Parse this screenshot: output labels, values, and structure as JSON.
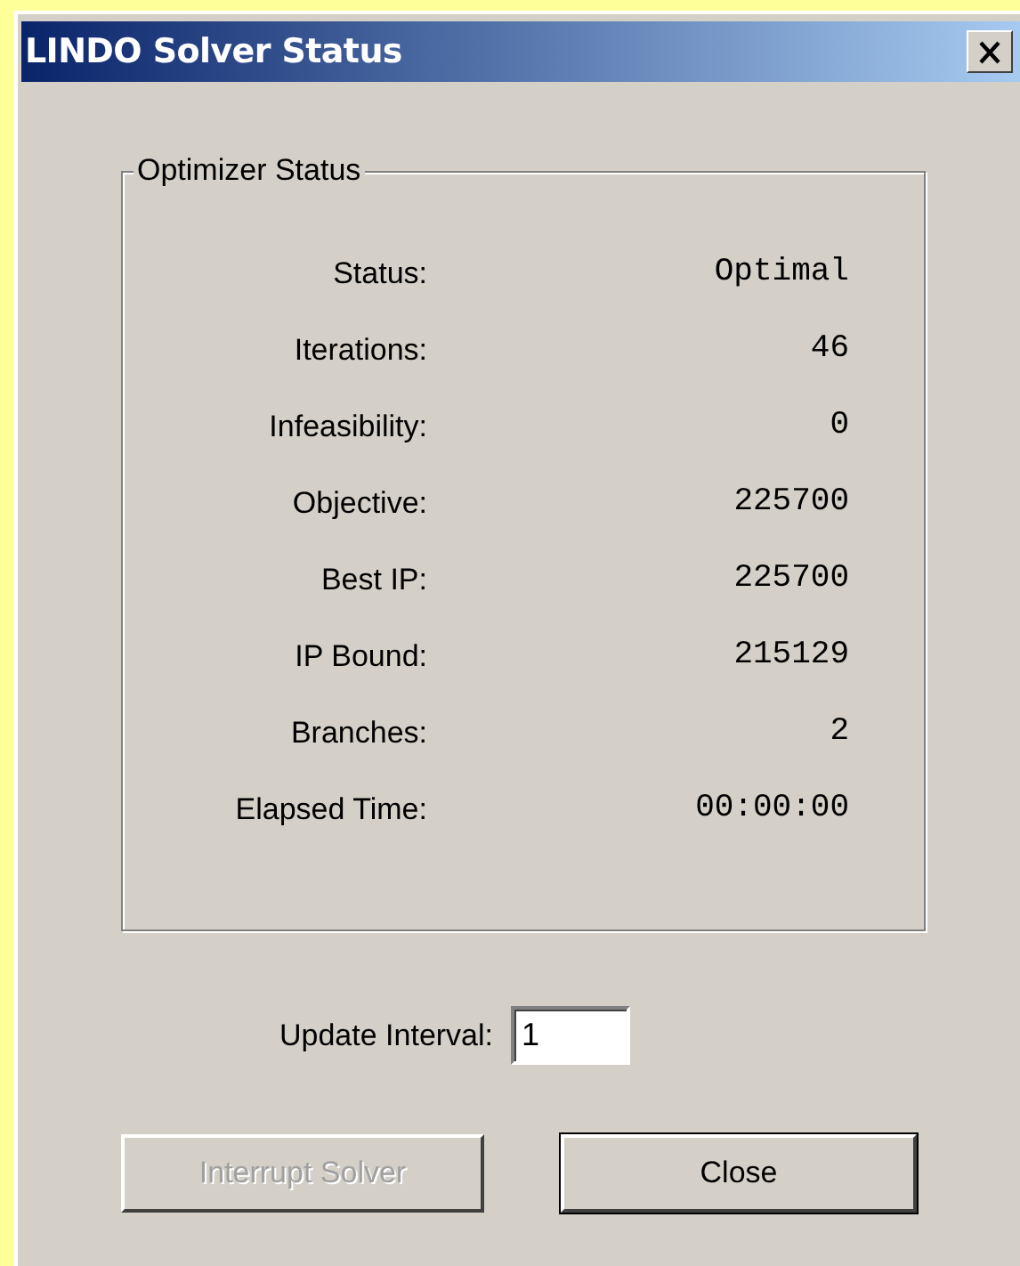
{
  "window": {
    "title": "LINDO Solver Status"
  },
  "group": {
    "title": "Optimizer Status"
  },
  "fields": [
    {
      "label": "Status:",
      "value": "Optimal"
    },
    {
      "label": "Iterations:",
      "value": "46"
    },
    {
      "label": "Infeasibility:",
      "value": "0"
    },
    {
      "label": "Objective:",
      "value": "225700"
    },
    {
      "label": "Best IP:",
      "value": "225700"
    },
    {
      "label": "IP Bound:",
      "value": "215129"
    },
    {
      "label": "Branches:",
      "value": "2"
    },
    {
      "label": "Elapsed Time:",
      "value": "00:00:00"
    }
  ],
  "update_interval": {
    "label": "Update Interval:",
    "value": "1"
  },
  "buttons": [
    {
      "label": "Interrupt Solver",
      "disabled": true,
      "default": false
    },
    {
      "label": "Close",
      "disabled": false,
      "default": true
    }
  ]
}
